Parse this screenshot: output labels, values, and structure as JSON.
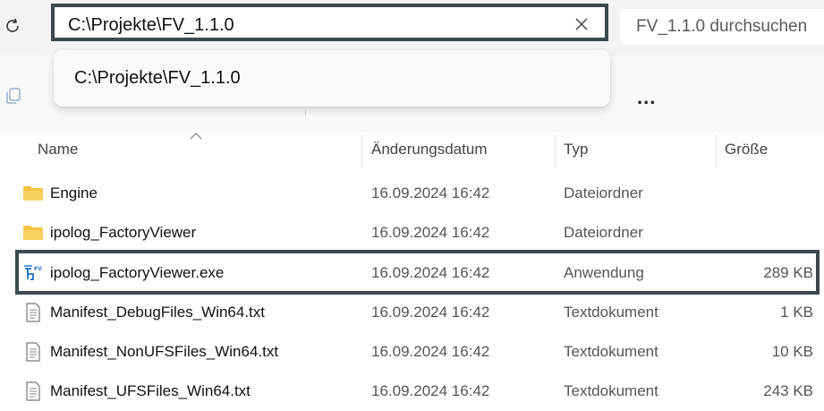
{
  "address_bar": {
    "path": "C:\\Projekte\\FV_1.1.0",
    "clear_icon": "close-icon"
  },
  "search": {
    "placeholder": "FV_1.1.0 durchsuchen"
  },
  "dropdown": {
    "suggestion": "C:\\Projekte\\FV_1.1.0"
  },
  "command_bar": {
    "more_label": "..."
  },
  "columns": {
    "name": "Name",
    "date": "Änderungsdatum",
    "type": "Typ",
    "size": "Größe"
  },
  "files": [
    {
      "name": "Engine",
      "date": "16.09.2024 16:42",
      "type": "Dateiordner",
      "size": "",
      "icon": "folder-icon"
    },
    {
      "name": "ipolog_FactoryViewer",
      "date": "16.09.2024 16:42",
      "type": "Dateiordner",
      "size": "",
      "icon": "folder-icon"
    },
    {
      "name": "ipolog_FactoryViewer.exe",
      "date": "16.09.2024 16:42",
      "type": "Anwendung",
      "size": "289 KB",
      "icon": "factoryviewer-app-icon"
    },
    {
      "name": "Manifest_DebugFiles_Win64.txt",
      "date": "16.09.2024 16:42",
      "type": "Textdokument",
      "size": "1 KB",
      "icon": "text-file-icon"
    },
    {
      "name": "Manifest_NonUFSFiles_Win64.txt",
      "date": "16.09.2024 16:42",
      "type": "Textdokument",
      "size": "10 KB",
      "icon": "text-file-icon"
    },
    {
      "name": "Manifest_UFSFiles_Win64.txt",
      "date": "16.09.2024 16:42",
      "type": "Textdokument",
      "size": "243 KB",
      "icon": "text-file-icon"
    }
  ],
  "colors": {
    "highlight_border": "#3c4a4f",
    "folder_yellow": "#f4c542",
    "app_icon_blue": "#1a73c8"
  }
}
